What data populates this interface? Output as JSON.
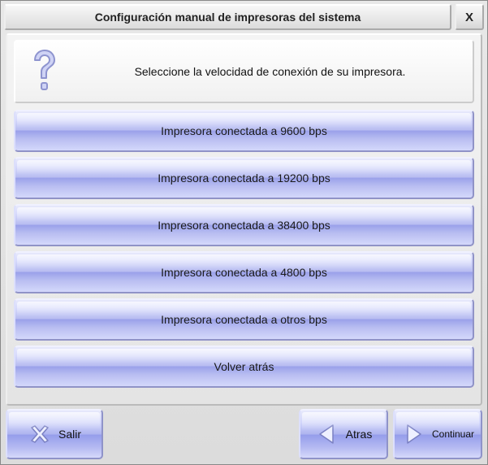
{
  "window": {
    "title": "Configuración manual de impresoras del sistema",
    "close_label": "X"
  },
  "prompt": {
    "text": "Seleccione la velocidad de conexión de su impresora."
  },
  "options": [
    {
      "label": "Impresora conectada a 9600 bps"
    },
    {
      "label": "Impresora conectada a 19200 bps"
    },
    {
      "label": "Impresora conectada a 38400 bps"
    },
    {
      "label": "Impresora conectada a 4800 bps"
    },
    {
      "label": "Impresora conectada a otros bps"
    },
    {
      "label": "Volver atrás"
    }
  ],
  "footer": {
    "exit_label": "Salir",
    "back_label": "Atras",
    "next_label": "Continuar"
  },
  "colors": {
    "button_blue_light": "#d7dafc",
    "button_blue_dark": "#9aa1ea",
    "border": "#9093c7"
  }
}
